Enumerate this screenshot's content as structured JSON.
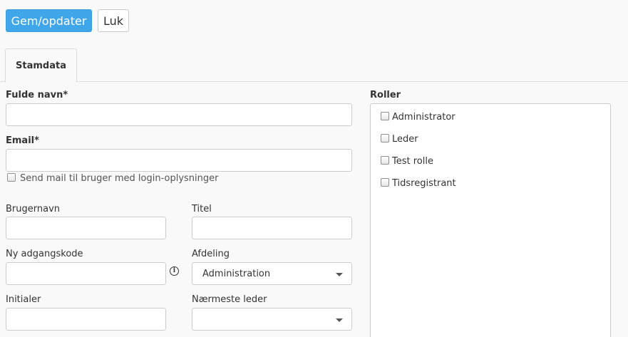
{
  "toolbar": {
    "save_label": "Gem/opdater",
    "close_label": "Luk"
  },
  "tabs": [
    {
      "label": "Stamdata",
      "active": true
    }
  ],
  "form": {
    "full_name_label": "Fulde navn*",
    "full_name_value": "",
    "email_label": "Email*",
    "email_value": "",
    "send_mail_label": "Send mail til bruger med login-oplysninger",
    "send_mail_checked": false,
    "username_label": "Brugernavn",
    "username_value": "",
    "title_label": "Titel",
    "title_value": "",
    "new_password_label": "Ny adgangskode",
    "new_password_value": "",
    "department_label": "Afdeling",
    "department_value": "Administration",
    "initials_label": "Initialer",
    "initials_value": "",
    "manager_label": "Nærmeste leder",
    "manager_value": ""
  },
  "roles": {
    "label": "Roller",
    "items": [
      {
        "label": "Administrator",
        "checked": false
      },
      {
        "label": "Leder",
        "checked": false
      },
      {
        "label": "Test rolle",
        "checked": false
      },
      {
        "label": "Tidsregistrant",
        "checked": false
      }
    ]
  },
  "colors": {
    "primary": "#3fa6ea",
    "background": "#f9f9f9",
    "border": "#cccccc"
  }
}
